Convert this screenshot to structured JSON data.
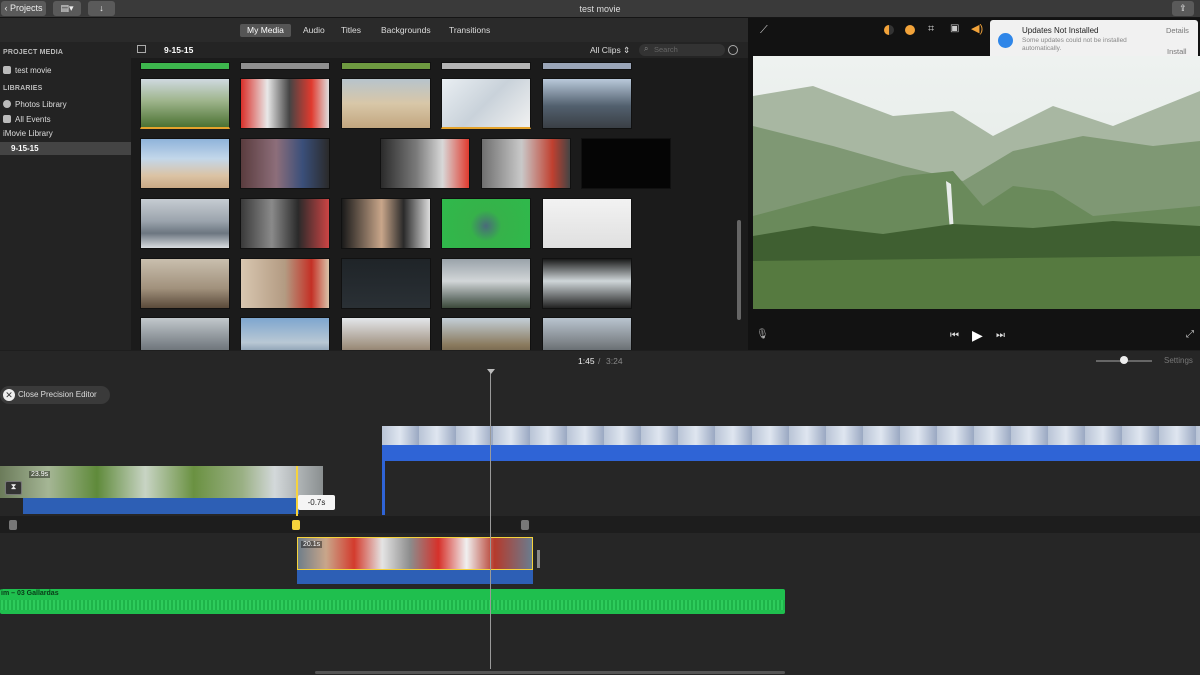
{
  "window": {
    "title": "test movie",
    "projects_label": "Projects",
    "share_icon": "share-icon"
  },
  "tabs": [
    {
      "label": "My Media",
      "active": true
    },
    {
      "label": "Audio",
      "active": false
    },
    {
      "label": "Titles",
      "active": false
    },
    {
      "label": "Backgrounds",
      "active": false
    },
    {
      "label": "Transitions",
      "active": false
    }
  ],
  "sidebar": {
    "project_media_header": "PROJECT MEDIA",
    "project_item": "test movie",
    "libraries_header": "LIBRARIES",
    "items": [
      {
        "label": "Photos Library"
      },
      {
        "label": "All Events"
      },
      {
        "label": "iMovie Library"
      },
      {
        "label": "9-15-15",
        "selected": true
      }
    ]
  },
  "browser": {
    "event_title": "9-15-15",
    "filter": "All Clips",
    "search_placeholder": "Search"
  },
  "notification": {
    "title": "Updates Not Installed",
    "body": "Some updates could not be installed automatically.",
    "details": "Details",
    "install": "Install"
  },
  "transport": {
    "current_time": "1:45",
    "separator": "/",
    "total_time": "3:24",
    "settings_label": "Settings"
  },
  "timeline": {
    "close_precision_editor": "Close Precision Editor",
    "offset_badge": "-0.7s",
    "audio_track_label": "im – 03 Gallardas",
    "clip_duration": "23.9s",
    "cutaway_duration": "20.1s"
  },
  "colors": {
    "accent_blue": "#2f64d6",
    "audio_green": "#1fbf4e",
    "selection_yellow": "#f6d33c"
  }
}
